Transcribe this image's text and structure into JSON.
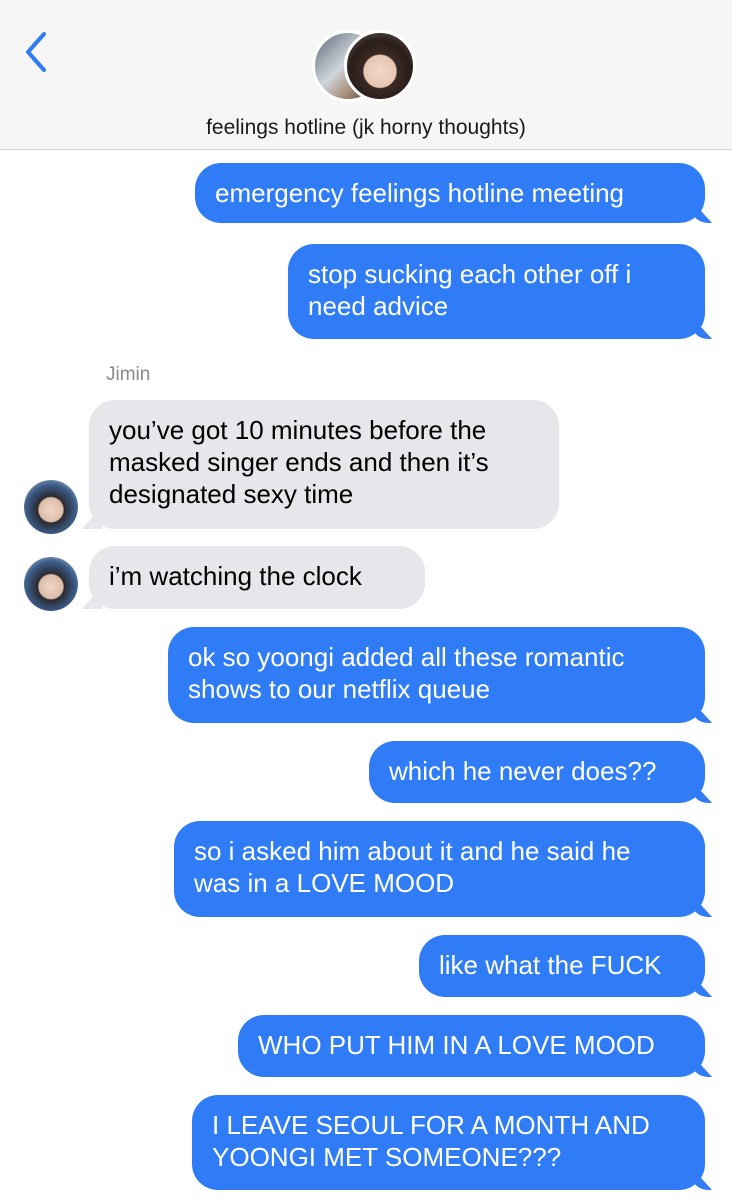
{
  "header": {
    "back_icon": "chevron-left-icon",
    "title": "feelings hotline (jk horny thoughts)"
  },
  "colors": {
    "sent_bubble": "#2f7cf6",
    "received_bubble": "#e6e6eb",
    "accent": "#2f7cf6"
  },
  "messages": [
    {
      "type": "sent",
      "text": "emergency feelings hotline meeting"
    },
    {
      "type": "sent",
      "text": "stop sucking each other off i\nneed advice"
    },
    {
      "type": "sender_name",
      "text": "Jimin"
    },
    {
      "type": "received",
      "text": "you’ve got 10 minutes before the\nmasked singer ends and then it’s\ndesignated sexy time"
    },
    {
      "type": "received",
      "text": "i’m watching the clock"
    },
    {
      "type": "sent",
      "text": "ok so yoongi added all these romantic\nshows to our netflix queue"
    },
    {
      "type": "sent",
      "text": "which he never does??"
    },
    {
      "type": "sent",
      "text": "so i asked him about it and he said he\nwas in a LOVE MOOD"
    },
    {
      "type": "sent",
      "text": "like what the FUCK"
    },
    {
      "type": "sent",
      "text": "WHO PUT HIM IN A LOVE MOOD"
    },
    {
      "type": "sent",
      "text": "I LEAVE SEOUL FOR A MONTH AND\nYOONGI MET SOMEONE???"
    }
  ]
}
